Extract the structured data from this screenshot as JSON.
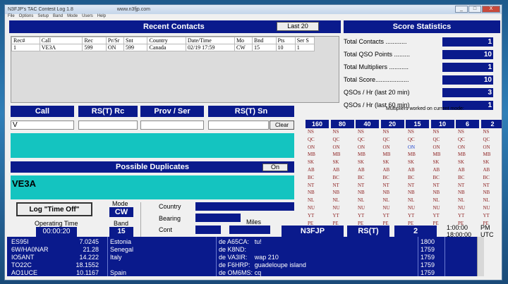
{
  "window": {
    "title": "N3FJP's TAC Contest Log 1.8",
    "url_hint": "www.n3fjp.com",
    "buttons": [
      "_",
      "□",
      "X"
    ]
  },
  "menu": [
    "File",
    "Options",
    "Setup",
    "Band",
    "Mode",
    "Users",
    "Help"
  ],
  "recent": {
    "title": "Recent Contacts",
    "last_button": "Last 20",
    "columns": [
      "Rec#",
      "Call",
      "Rec",
      "Pr/Sr",
      "Snt",
      "Country",
      "Date/Time",
      "Mo",
      "Bnd",
      "Pts",
      "Ser S"
    ],
    "rows": [
      [
        "1",
        "VE3A",
        "599",
        "ON",
        "599",
        "Canada",
        "02/19 17:59",
        "CW",
        "15",
        "10",
        "1"
      ]
    ]
  },
  "score": {
    "title": "Score Statistics",
    "items": [
      {
        "label": "Total Contacts ............",
        "value": "1"
      },
      {
        "label": "Total QSO Points .........",
        "value": "10"
      },
      {
        "label": "Total Multipliers ...........",
        "value": "1"
      },
      {
        "label": "Total Score...................",
        "value": "10"
      },
      {
        "label": "QSOs / Hr (last 20 min)",
        "value": "3"
      },
      {
        "label": "QSOs / Hr (last 60 min)",
        "value": "1"
      }
    ]
  },
  "entry": {
    "call_label": "Call",
    "rst_rc_label": "RS(T) Rc",
    "prov_label": "Prov / Ser",
    "rst_sn_label": "RS(T) Sn",
    "call_value": "V",
    "clear_button": "Clear"
  },
  "dupes": {
    "title": "Possible Duplicates",
    "on_button": "On",
    "value": "VE3A"
  },
  "mults": {
    "caption": "Multipliers worked on current mode:",
    "bands": [
      "160",
      "80",
      "40",
      "20",
      "15",
      "10",
      "6",
      "2"
    ],
    "prov": [
      "NS",
      "QC",
      "ON",
      "MB",
      "SK",
      "AB",
      "BC",
      "NT",
      "NB",
      "NL",
      "NU",
      "YT",
      "PE"
    ],
    "worked_band": "15",
    "worked_prov": "ON"
  },
  "controls": {
    "time_off_button": "Log \"Time Off\"",
    "mode_label": "Mode",
    "mode_value": "CW",
    "optime_label": "Operating Time",
    "optime_value": "00:00:20",
    "band_label": "Band",
    "band_value": "15",
    "country_label": "Country",
    "bearing_label": "Bearing",
    "cont_label": "Cont",
    "miles_label": "Miles"
  },
  "status": {
    "call": "N3FJP",
    "rst": "RS(T)",
    "serial": "2",
    "local_time": "1:00:00",
    "ampm": "PM",
    "utc_time": "18:00:00",
    "utc": "UTC"
  },
  "spots": [
    {
      "call": "ES95I",
      "freq": "7.0245",
      "country": "Estonia",
      "spotter": "de A65CA:",
      "comment": "tu!",
      "time": "1800"
    },
    {
      "call": "6W/HA0NAR",
      "freq": "21.28",
      "country": "Senegal",
      "spotter": "de K8ND:",
      "comment": "",
      "time": "1759"
    },
    {
      "call": "IO5ANT",
      "freq": "14.222",
      "country": "Italy",
      "spotter": "de VA3IR:",
      "comment": "wap 210",
      "time": "1759"
    },
    {
      "call": "TO22C",
      "freq": "18.1552",
      "country": "",
      "spotter": "de F6HRP:",
      "comment": "guadeloupe island",
      "time": "1759"
    },
    {
      "call": "AO1UCE",
      "freq": "10.1167",
      "country": "Spain",
      "spotter": "de OM6MS:",
      "comment": "cq",
      "time": "1759"
    }
  ]
}
